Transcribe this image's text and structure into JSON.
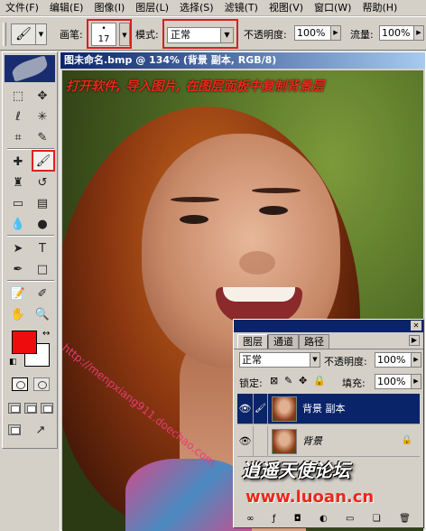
{
  "menu": [
    "文件(F)",
    "编辑(E)",
    "图像(I)",
    "图层(L)",
    "选择(S)",
    "滤镜(T)",
    "视图(V)",
    "窗口(W)",
    "帮助(H)"
  ],
  "options": {
    "brush_label": "画笔:",
    "brush_size": "17",
    "mode_label": "模式:",
    "mode_value": "正常",
    "opacity_label": "不透明度:",
    "opacity_value": "100%",
    "flow_label": "流量:",
    "flow_value": "100%"
  },
  "document": {
    "title": "图未命名.bmp @ 134% (背景 副本, RGB/8)",
    "caption": "打开软件, 导入图片, 在图层面板中复制背景层",
    "watermark_url": "http://menpxiang911.doechao.com"
  },
  "colors": {
    "foreground": "#ee0c0c",
    "background": "#ffffff",
    "title_bar": "#0a246a"
  },
  "layers_panel": {
    "tabs": [
      "图层",
      "通道",
      "路径"
    ],
    "blend_mode": "正常",
    "opacity_label": "不透明度:",
    "opacity_value": "100%",
    "lock_label": "锁定:",
    "fill_label": "填充:",
    "fill_value": "100%",
    "layers": [
      {
        "name": "背景 副本",
        "selected": true
      },
      {
        "name": "背景",
        "selected": false,
        "locked": true
      }
    ]
  },
  "site_logo": {
    "text": "逍遥天使论坛",
    "url": "www.luoan.cn"
  }
}
